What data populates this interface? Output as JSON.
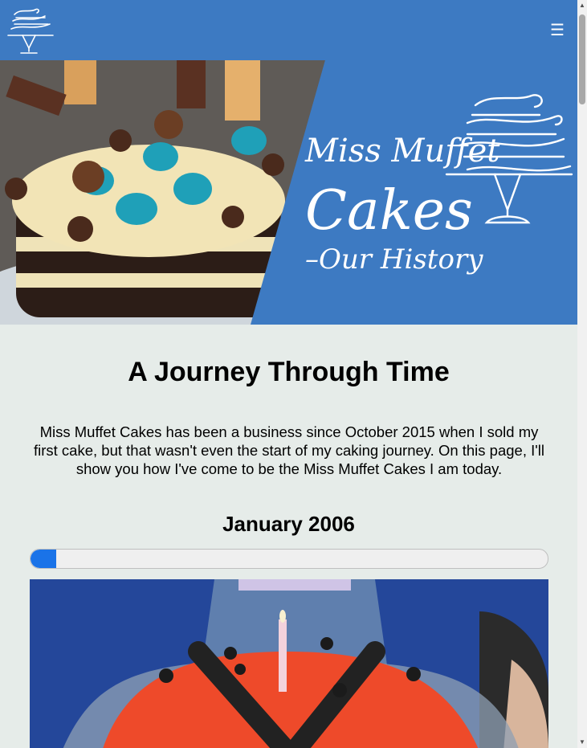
{
  "header": {
    "logo_name": "cake-stand-logo",
    "menu_label": "☰"
  },
  "hero": {
    "title_line1": "Miss Muffet",
    "title_line2": "Cakes",
    "title_line3": "–Our History",
    "photo": "drip-cake-photo"
  },
  "main": {
    "heading": "A Journey Through Time",
    "intro": "Miss Muffet Cakes has been a business since October 2015 when I sold my first cake, but that wasn't even the start of my caking journey. On this page, I'll show you how I've come to be the Miss Muffet Cakes I am today.",
    "timeline": {
      "date": "January 2006",
      "progress": 0.05,
      "photo": "ladybird-cake-photo"
    }
  },
  "colors": {
    "brand_blue": "#3d7ac2",
    "page_bg": "#e6ece9",
    "progress_fill": "#1a73e8"
  }
}
